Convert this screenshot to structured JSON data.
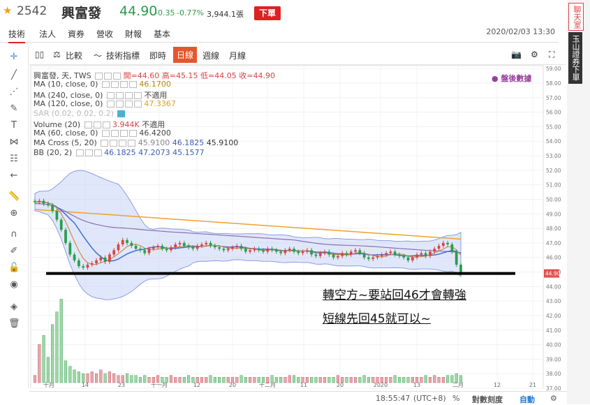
{
  "header": {
    "code": "2542",
    "name": "興富發",
    "price": "44.90",
    "change": "-0.35",
    "change_pct": "-0.77%",
    "volume": "3,944.1張",
    "order_button": "下單",
    "datetime": "2020/02/03 13:30"
  },
  "tabs": [
    "技術",
    "法人",
    "資券",
    "營收",
    "財報",
    "基本"
  ],
  "side": {
    "chat": "聊天室",
    "bank": "玉山證券下單"
  },
  "toolbar": {
    "compare": "比較",
    "indicators": "技術指標",
    "intraday": "即時",
    "daily": "日線",
    "weekly": "週線",
    "monthly": "月線"
  },
  "legend": {
    "main": {
      "label": "興富發, 天, TWS",
      "open": "開=44.60",
      "high": "高=45.15",
      "low": "低=44.05",
      "close": "收=44.90"
    },
    "ma10": {
      "label": "MA (10, close, 0)",
      "value": "46.1700"
    },
    "ma240": {
      "label": "MA (240, close, 0)",
      "value": "不適用"
    },
    "ma120": {
      "label": "MA (120, close, 0)",
      "value": "47.3367"
    },
    "sar": {
      "label": "SAR (0.02, 0.02, 0.2)"
    },
    "volume": {
      "label": "Volume (20)",
      "value": "3.944K",
      "value2": "不適用"
    },
    "ma60": {
      "label": "MA (60, close, 0)",
      "value": "46.4200"
    },
    "macross": {
      "label": "MA Cross (5, 20)",
      "v1": "45.9100",
      "v2": "46.1825",
      "v3": "45.9100"
    },
    "bb": {
      "label": "BB (20, 2)",
      "v1": "46.1825",
      "v2": "47.2073",
      "v3": "45.1577"
    }
  },
  "after_hours": "● 盤後數據",
  "annotations": [
    "轉空方~要站回46才會轉強",
    "短線先回45就可以~"
  ],
  "bottom": {
    "time": "18:55:47",
    "tz": "(UTC+8)",
    "pct": "%",
    "log": "對數刻度",
    "auto": "自動"
  },
  "colors": {
    "up": "#d64545",
    "down": "#2a9d4a",
    "bb": "#8b9be6",
    "ma120": "#f0a030",
    "ma60": "#8a6fb0",
    "ma10": "#3a6fd8",
    "ma5": "#d08a4a",
    "price_tag": "#e05050"
  },
  "chart_data": {
    "type": "candlestick",
    "x_ticks": [
      "十月",
      "14",
      "23",
      "十一月",
      "12",
      "20",
      "十二月",
      "11",
      "20",
      "2020",
      "13",
      "二月",
      "12",
      "21"
    ],
    "y_ticks": [
      "59.00",
      "58.00",
      "57.00",
      "56.00",
      "55.00",
      "54.00",
      "53.00",
      "52.00",
      "51.00",
      "50.00",
      "49.00",
      "48.00",
      "47.00",
      "46.00",
      "45.00",
      "44.00",
      "43.00",
      "42.00",
      "41.00",
      "40.00",
      "39.00",
      "38.00",
      "37.00"
    ],
    "ylim": [
      37,
      59.2
    ],
    "last_price_label": "44.90",
    "support_line": 44.9,
    "closes": [
      49.8,
      49.9,
      49.7,
      49.6,
      49.2,
      48.6,
      47.9,
      47.0,
      46.2,
      45.8,
      45.4,
      45.3,
      45.5,
      45.6,
      45.8,
      46.0,
      45.7,
      46.2,
      46.5,
      46.9,
      47.2,
      47.0,
      46.8,
      46.6,
      46.5,
      46.3,
      46.6,
      46.7,
      46.8,
      46.6,
      46.5,
      46.7,
      46.9,
      47.0,
      46.8,
      46.7,
      46.6,
      46.8,
      46.9,
      47.0,
      46.8,
      46.7,
      46.6,
      46.5,
      46.6,
      46.7,
      46.8,
      46.6,
      46.4,
      46.5,
      46.6,
      46.5,
      46.4,
      46.6,
      46.5,
      46.4,
      46.3,
      46.5,
      46.6,
      46.4,
      46.3,
      46.4,
      46.5,
      46.2,
      46.1,
      46.3,
      46.4,
      46.2,
      46.0,
      46.1,
      46.3,
      46.2,
      46.4,
      46.5,
      46.3,
      46.0,
      45.9,
      46.0,
      46.1,
      46.2,
      46.3,
      46.4,
      46.2,
      46.1,
      46.0,
      45.8,
      46.0,
      46.2,
      46.3,
      46.1,
      46.4,
      46.6,
      46.8,
      47.0,
      46.9,
      46.4,
      45.5,
      44.9
    ],
    "volumes": [
      0.4,
      2.1,
      2.6,
      1.4,
      3.2,
      3.9,
      4.6,
      1.2,
      0.9,
      0.7,
      0.6,
      0.5,
      0.5,
      0.6,
      0.5,
      0.7,
      0.5,
      0.6,
      0.5,
      0.4,
      0.4,
      0.5,
      0.4,
      0.4,
      0.3,
      0.4,
      0.3,
      0.3,
      0.4,
      0.3,
      0.3,
      0.4,
      0.3,
      0.3,
      0.3,
      0.4,
      0.3,
      0.3,
      0.3,
      0.3,
      0.4,
      0.3,
      0.3,
      0.3,
      0.3,
      0.3,
      0.3,
      0.4,
      0.3,
      0.3,
      0.3,
      0.3,
      0.3,
      0.3,
      0.4,
      0.3,
      0.3,
      0.3,
      0.4,
      0.4,
      0.3,
      0.3,
      0.3,
      0.3,
      0.3,
      0.3,
      0.3,
      0.3,
      0.3,
      0.4,
      0.3,
      0.3,
      0.3,
      0.3,
      0.3,
      0.4,
      0.3,
      0.3,
      0.3,
      0.3,
      0.3,
      0.3,
      0.4,
      0.3,
      0.3,
      0.3,
      0.3,
      0.3,
      0.3,
      0.4,
      0.3,
      0.4,
      0.3,
      0.3,
      0.4,
      0.4,
      0.5,
      0.4
    ]
  }
}
